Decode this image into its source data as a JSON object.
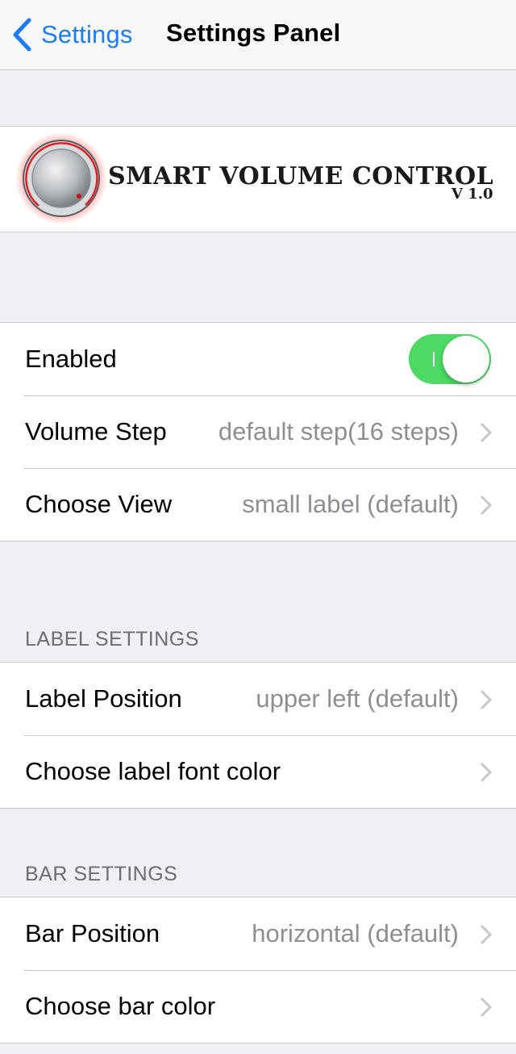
{
  "navbar": {
    "back_label": "Settings",
    "title": "Settings Panel",
    "back_icon": "chevron-left-icon",
    "accent_color": "#1a7cf9"
  },
  "banner": {
    "title": "SMART VOLUME CONTROL",
    "version": "V 1.0",
    "logo_icon": "volume-knob-icon"
  },
  "main_group": {
    "enabled_label": "Enabled",
    "enabled_on": true,
    "toggle_color": "#4cd964",
    "volume_step_label": "Volume Step",
    "volume_step_value": "default step(16 steps)",
    "choose_view_label": "Choose View",
    "choose_view_value": "small label (default)"
  },
  "label_settings": {
    "header": "LABEL SETTINGS",
    "label_position_label": "Label Position",
    "label_position_value": "upper left (default)",
    "font_color_label": "Choose label font color"
  },
  "bar_settings": {
    "header": "BAR SETTINGS",
    "bar_position_label": "Bar Position",
    "bar_position_value": "horizontal (default)",
    "bar_color_label": "Choose bar color"
  }
}
